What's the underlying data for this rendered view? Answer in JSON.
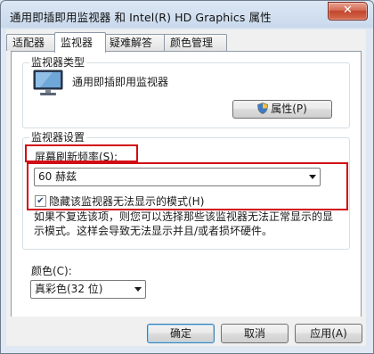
{
  "window": {
    "title": "通用即插即用监视器 和 Intel(R) HD Graphics 属性",
    "close_glyph": "✕"
  },
  "tabs": [
    {
      "label": "适配器"
    },
    {
      "label": "监视器"
    },
    {
      "label": "疑难解答"
    },
    {
      "label": "颜色管理"
    }
  ],
  "monitor_type": {
    "group_label": "监视器类型",
    "monitor_name": "通用即插即用监视器",
    "properties_button": "属性(P)"
  },
  "monitor_settings": {
    "group_label": "监视器设置",
    "refresh_rate_label": "屏幕刷新频率(S):",
    "refresh_rate_value": "60 赫兹",
    "hide_modes_label": "隐藏该监视器无法显示的模式(H)",
    "hide_modes_checked": true,
    "warning_text": "如果不复选该项，则您可以选择那些该监视器无法正常显示的显示模式。这样会导致无法显示并且/或者损坏硬件。"
  },
  "colors": {
    "label": "颜色(C):",
    "value": "真彩色(32 位)"
  },
  "footer": {
    "ok_button": "确定",
    "cancel_button": "取消",
    "apply_button": "应用(A)"
  },
  "highlight_color": "#d20d13",
  "icons": [
    "monitor-icon",
    "shield-icon",
    "close-icon",
    "chevron-down-icon"
  ]
}
